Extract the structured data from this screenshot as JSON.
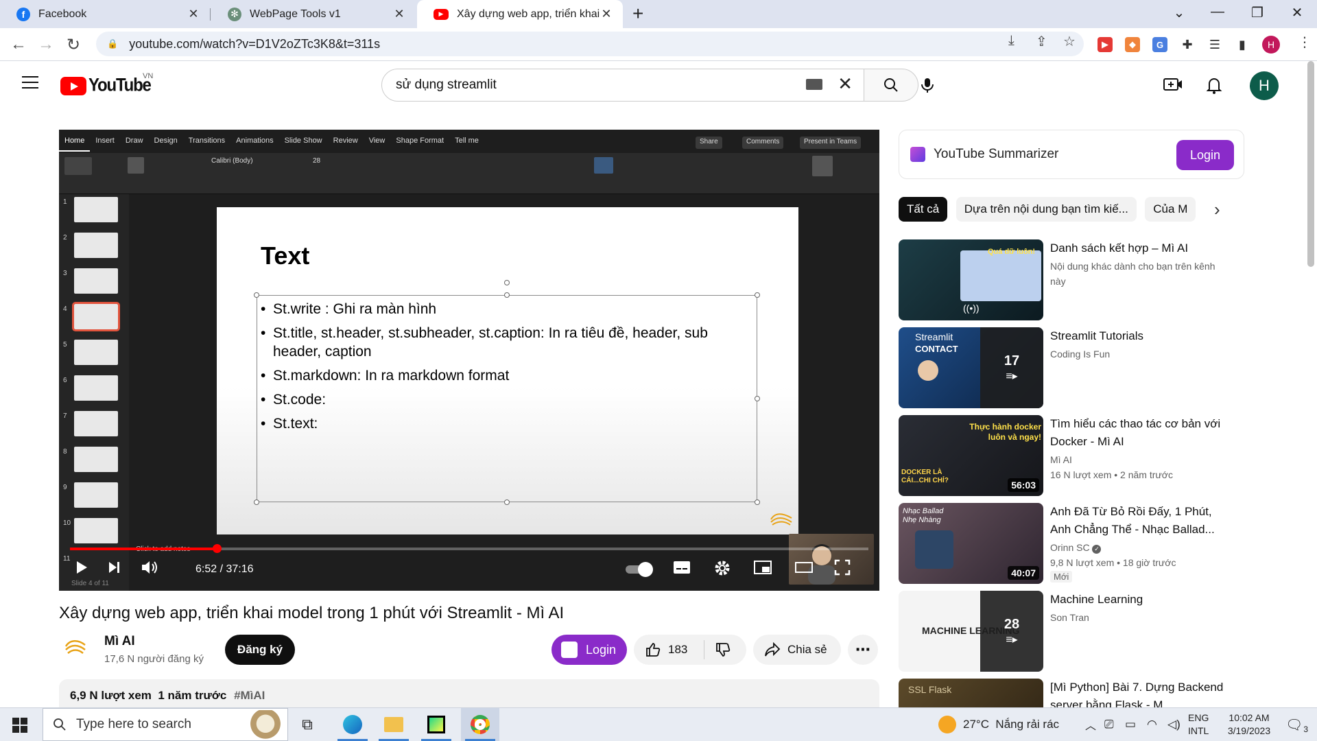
{
  "browser": {
    "tabs": [
      {
        "title": "Facebook",
        "icon": "facebook-icon",
        "color": "#1877f2"
      },
      {
        "title": "WebPage Tools v1",
        "icon": "chatgpt-icon",
        "color": "#6b8f7a"
      },
      {
        "title": "Xây dựng web app, triển khai mô",
        "icon": "youtube-icon",
        "color": "#ff0000"
      }
    ],
    "url": "youtube.com/watch?v=D1V2oZTc3K8&t=311s",
    "profile_initial": "H"
  },
  "youtube": {
    "logo_text": "YouTube",
    "country": "VN",
    "search_value": "sử dụng streamlit",
    "avatar_initial": "H"
  },
  "player": {
    "current_time": "6:52",
    "duration": "37:16",
    "time_sep": " / ",
    "progress": 0.184,
    "slide_title": "Text",
    "bullets": [
      "St.write : Ghi ra màn hình",
      "St.title, st.header, st.subheader, st.caption: In ra tiêu đề, header, sub header, caption",
      "St.markdown: In ra markdown format",
      "St.code:",
      "St.text:"
    ],
    "ribbon_tabs": [
      "Home",
      "Insert",
      "Draw",
      "Design",
      "Transitions",
      "Animations",
      "Slide Show",
      "Review",
      "View",
      "Shape Format",
      "Tell me"
    ],
    "ribbon_buttons": {
      "share": "Share",
      "comments": "Comments",
      "present": "Present in Teams"
    },
    "font_name": "Calibri (Body)",
    "font_size": "28",
    "notes_hint": "Click to add notes",
    "slide_status": "Slide 4 of 11",
    "slide_numbers": [
      "1",
      "2",
      "3",
      "4",
      "5",
      "6",
      "7",
      "8",
      "9",
      "10",
      "11"
    ]
  },
  "video": {
    "title": "Xây dựng web app, triển khai model trong 1 phút với Streamlit - Mì AI",
    "channel": "Mì AI",
    "subscribers": "17,6 N người đăng ký",
    "subscribe_label": "Đăng ký",
    "login_label": "Login",
    "likes": "183",
    "share_label": "Chia sẻ",
    "views": "6,9 N lượt xem",
    "age": "1 năm trước",
    "hashtag": "#MìAI"
  },
  "sidebar": {
    "summarizer_title": "YouTube Summarizer",
    "summarizer_login": "Login",
    "chips": [
      "Tất cả",
      "Dựa trên nội dung bạn tìm kiế...",
      "Của M"
    ],
    "recs": [
      {
        "title": "Danh sách kết hợp – Mì AI",
        "meta1": "Nội dung khác dành cho bạn trên kênh này",
        "meta2": "",
        "duration": "",
        "playlist_count": "",
        "badge": ""
      },
      {
        "title": "Streamlit Tutorials",
        "meta1": "Coding Is Fun",
        "meta2": "",
        "duration": "",
        "playlist_count": "17",
        "badge": ""
      },
      {
        "title": "Tìm hiểu các thao tác cơ bản với Docker - Mì AI",
        "meta1": "Mì AI",
        "meta2": "16 N lượt xem • 2 năm trước",
        "duration": "56:03",
        "playlist_count": "",
        "badge": ""
      },
      {
        "title": "Anh Đã Từ Bỏ Rồi Đấy, 1 Phút, Anh Chẳng Thể - Nhạc Ballad...",
        "meta1": "Orinn SC",
        "meta2": "9,8 N lượt xem • 18 giờ trước",
        "duration": "40:07",
        "playlist_count": "",
        "badge": "Mới"
      },
      {
        "title": "Machine Learning",
        "meta1": "Son Tran",
        "meta2": "",
        "duration": "",
        "playlist_count": "28",
        "badge": ""
      },
      {
        "title": "[Mì Python] Bài 7. Dựng Backend server bằng Flask - M...",
        "meta1": "",
        "meta2": "",
        "duration": "",
        "playlist_count": "",
        "badge": ""
      }
    ],
    "thumb_texts": {
      "r0": "Quá dữ luôn!",
      "r1a": "Streamlit",
      "r1b": "CONTACT",
      "r2a": "Thực hành docker luôn và ngay!",
      "r2b": "DOCKER LÀ CÁI...CHI CHỈ?",
      "r3": "Nhạc Ballad Nhẹ Nhàng",
      "r4": "MACHINE LEARNING",
      "r5": "SSL Flask"
    }
  },
  "taskbar": {
    "search_placeholder": "Type here to search",
    "weather": "27°C  Nắng rải rác",
    "lang1": "ENG",
    "lang2": "INTL",
    "time": "10:02 AM",
    "date": "3/19/2023",
    "notif_count": "3"
  }
}
